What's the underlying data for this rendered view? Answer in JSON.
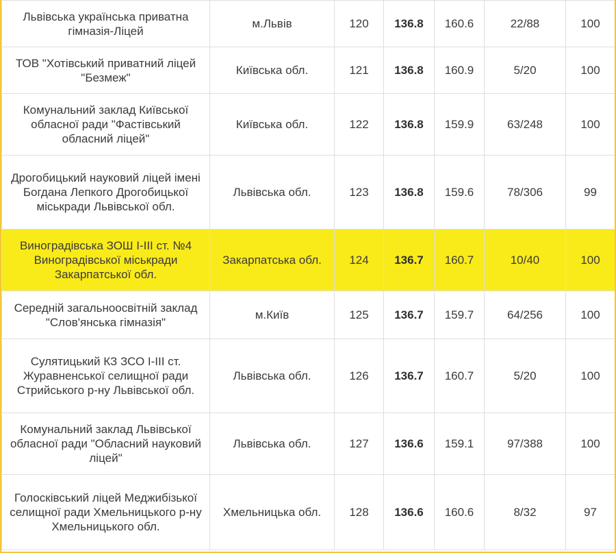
{
  "table": {
    "rows": [
      {
        "name": "Львівська українська приватна гімназія-Ліцей",
        "region": "м.Львів",
        "rank": "120",
        "score": "136.8",
        "max": "160.6",
        "ratio": "22/88",
        "pct": "100",
        "highlight": false
      },
      {
        "name": "ТОВ \"Хотівський приватний ліцей \"Безмеж\"",
        "region": "Київська обл.",
        "rank": "121",
        "score": "136.8",
        "max": "160.9",
        "ratio": "5/20",
        "pct": "100",
        "highlight": false
      },
      {
        "name": "Комунальний заклад Київської обласної ради \"Фастівський обласний ліцей\"",
        "region": "Київська обл.",
        "rank": "122",
        "score": "136.8",
        "max": "159.9",
        "ratio": "63/248",
        "pct": "100",
        "highlight": false
      },
      {
        "name": "Дрогобицький науковий ліцей імені Богдана Лепкого Дрогобицької міськради Львівської обл.",
        "region": "Львівська обл.",
        "rank": "123",
        "score": "136.8",
        "max": "159.6",
        "ratio": "78/306",
        "pct": "99",
        "highlight": false
      },
      {
        "name": "Виноградівська ЗОШ І-ІІІ ст. №4 Виноградівської міськради Закарпатської обл.",
        "region": "Закарпатська обл.",
        "rank": "124",
        "score": "136.7",
        "max": "160.7",
        "ratio": "10/40",
        "pct": "100",
        "highlight": true
      },
      {
        "name": "Середній загальноосвітній заклад \"Слов'янська гімназія\"",
        "region": "м.Київ",
        "rank": "125",
        "score": "136.7",
        "max": "159.7",
        "ratio": "64/256",
        "pct": "100",
        "highlight": false
      },
      {
        "name": "Сулятицький КЗ ЗСО І-ІІІ ст. Журавненської селищної ради Стрийського р-ну Львівської обл.",
        "region": "Львівська обл.",
        "rank": "126",
        "score": "136.7",
        "max": "160.7",
        "ratio": "5/20",
        "pct": "100",
        "highlight": false
      },
      {
        "name": "Комунальний заклад Львівської обласної ради \"Обласний науковий ліцей\"",
        "region": "Львівська обл.",
        "rank": "127",
        "score": "136.6",
        "max": "159.1",
        "ratio": "97/388",
        "pct": "100",
        "highlight": false
      },
      {
        "name": "Голосківський ліцей Меджибізької селищної ради Хмельницького р-ну Хмельницького обл.",
        "region": "Хмельницька обл.",
        "rank": "128",
        "score": "136.6",
        "max": "160.6",
        "ratio": "8/32",
        "pct": "97",
        "highlight": false
      }
    ]
  },
  "colors": {
    "highlight": "#f9ea1a",
    "frame": "#f2c53b",
    "grid": "#dedede",
    "text": "#3a3a3a"
  }
}
